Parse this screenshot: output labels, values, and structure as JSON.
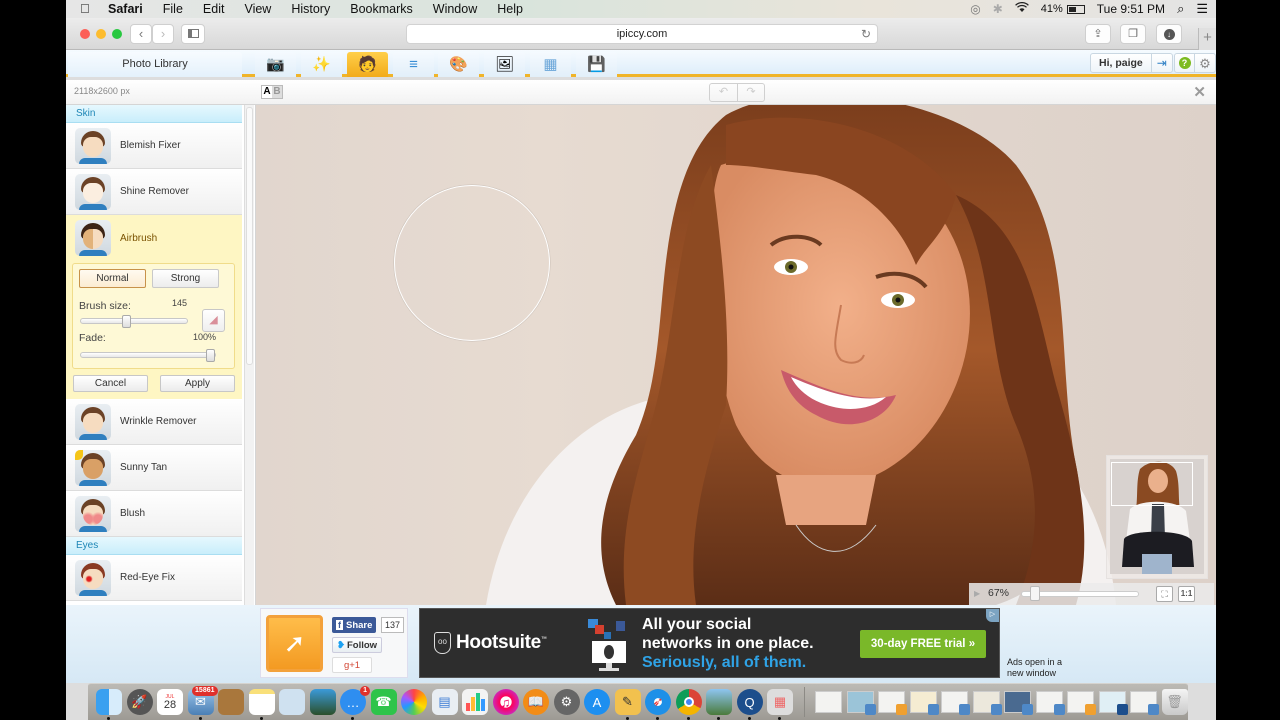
{
  "menubar": {
    "app": "Safari",
    "items": [
      "File",
      "Edit",
      "View",
      "History",
      "Bookmarks",
      "Window",
      "Help"
    ],
    "battery": "41%",
    "clock": "Tue 9:51 PM"
  },
  "browser": {
    "url": "ipiccy.com"
  },
  "app_header": {
    "photo_library": "Photo Library",
    "tabs": [
      {
        "name": "camera",
        "icon": "📷"
      },
      {
        "name": "magic-wand",
        "icon": "✨"
      },
      {
        "name": "retouch-face",
        "icon": "🧑"
      },
      {
        "name": "layers",
        "icon": "≡"
      },
      {
        "name": "paint-palette",
        "icon": "🎨"
      },
      {
        "name": "frame",
        "icon": "🖼"
      },
      {
        "name": "texture",
        "icon": "▦"
      },
      {
        "name": "save",
        "icon": "💾"
      }
    ],
    "active_tab": "retouch-face",
    "greeting": "Hi, paige"
  },
  "subheader": {
    "image_dimensions": "2118x2600 px",
    "compare_a": "A",
    "compare_b": "B"
  },
  "sidebar": {
    "sections": [
      {
        "title": "Skin",
        "items": [
          {
            "label": "Blemish Fixer"
          },
          {
            "label": "Shine Remover"
          },
          {
            "label": "Airbrush",
            "active": true
          },
          {
            "label": "Wrinkle Remover"
          },
          {
            "label": "Sunny Tan"
          },
          {
            "label": "Blush"
          }
        ]
      },
      {
        "title": "Eyes",
        "items": [
          {
            "label": "Red-Eye Fix"
          }
        ]
      }
    ],
    "airbrush": {
      "mode_normal": "Normal",
      "mode_strong": "Strong",
      "selected_mode": "Normal",
      "brush_size_label": "Brush size:",
      "brush_size_value": "145",
      "brush_size_fraction": 0.42,
      "fade_label": "Fade:",
      "fade_value": "100%",
      "fade_fraction": 1.0,
      "cancel": "Cancel",
      "apply": "Apply"
    }
  },
  "canvas": {
    "zoom_value": "67%",
    "zoom_fraction": 0.05,
    "one_to_one": "1:1"
  },
  "ad_area": {
    "fb_share": "Share",
    "fb_count": "137",
    "tw_follow": "Follow",
    "gplus": "g+1",
    "ad_brand": "Hootsuite",
    "ad_line1": "All your social",
    "ad_line2": "networks in one place.",
    "ad_line3": "Seriously, all of them.",
    "ad_cta": "30-day FREE trial »",
    "ads_note_1": "Ads open in a",
    "ads_note_2": "new window"
  },
  "dock": {
    "calendar_month": "JUL",
    "calendar_day": "28",
    "mail_badge": "15861",
    "messages_badge": "1"
  }
}
